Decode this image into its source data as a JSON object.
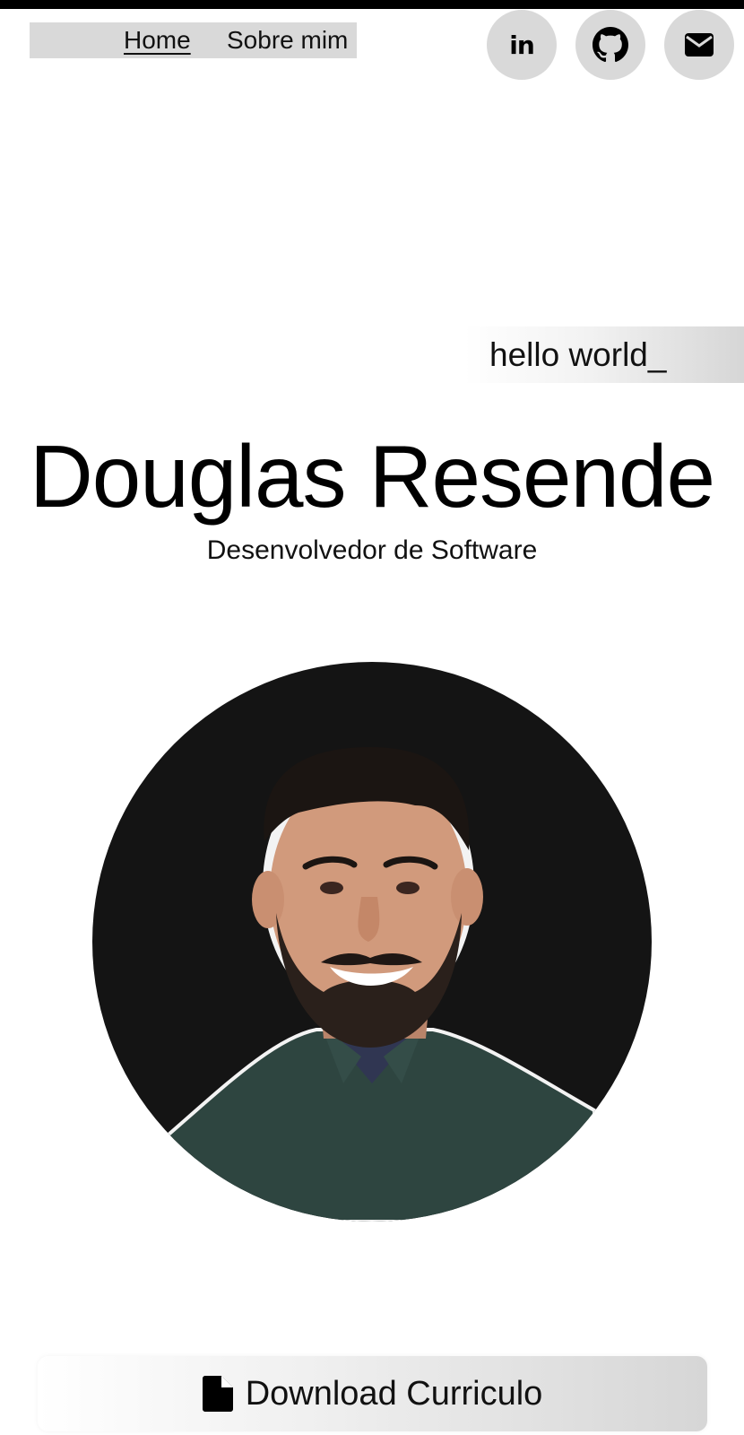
{
  "nav": {
    "items": [
      {
        "label": "Home"
      },
      {
        "label": "Sobre mim"
      }
    ]
  },
  "social": {
    "linkedin_glyph": "in",
    "icons": [
      "linkedin-icon",
      "github-icon",
      "email-icon"
    ]
  },
  "hero": {
    "greeting": "hello world_",
    "name": "Douglas Resende",
    "role": "Desenvolvedor de Software"
  },
  "download": {
    "label": "Download Curriculo",
    "icon": "file-icon"
  },
  "colors": {
    "top_bar": "#000000",
    "nav_bg": "#d9d9d9",
    "social_bg": "#d9d9d9",
    "photo_bg": "#141414"
  }
}
